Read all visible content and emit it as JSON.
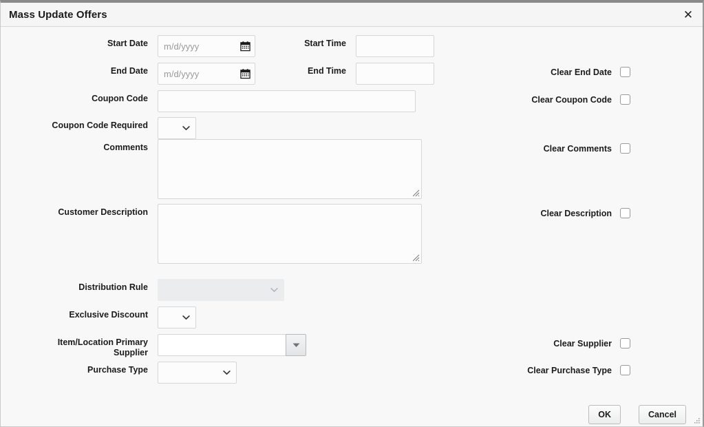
{
  "dialog": {
    "title": "Mass Update Offers",
    "close_icon": "close-icon"
  },
  "fields": {
    "start_date": {
      "label": "Start Date",
      "value": "",
      "placeholder": "m/d/yyyy",
      "icon": "calendar-icon"
    },
    "start_time": {
      "label": "Start Time",
      "value": "",
      "placeholder": ""
    },
    "end_date": {
      "label": "End Date",
      "value": "",
      "placeholder": "m/d/yyyy",
      "icon": "calendar-icon"
    },
    "end_time": {
      "label": "End Time",
      "value": "",
      "placeholder": ""
    },
    "coupon_code": {
      "label": "Coupon Code",
      "value": "",
      "placeholder": ""
    },
    "coupon_code_required": {
      "label": "Coupon Code Required",
      "value": "",
      "icon": "chevron-down-icon"
    },
    "comments": {
      "label": "Comments",
      "value": "",
      "placeholder": ""
    },
    "customer_description": {
      "label": "Customer Description",
      "value": "",
      "placeholder": ""
    },
    "distribution_rule": {
      "label": "Distribution Rule",
      "value": "",
      "disabled": true,
      "icon": "chevron-down-icon"
    },
    "exclusive_discount": {
      "label": "Exclusive Discount",
      "value": "",
      "icon": "chevron-down-icon"
    },
    "item_location_primary_supplier": {
      "label": "Item/Location Primary\nSupplier",
      "value": "",
      "placeholder": "",
      "icon": "dropdown-triangle-icon"
    },
    "purchase_type": {
      "label": "Purchase Type",
      "value": "",
      "icon": "chevron-down-icon"
    }
  },
  "clear_options": [
    {
      "label": "Clear End Date",
      "checked": false
    },
    {
      "label": "Clear Coupon Code",
      "checked": false
    },
    {
      "label": "Clear Comments",
      "checked": false
    },
    {
      "label": "Clear Description",
      "checked": false
    },
    {
      "label": "Clear Supplier",
      "checked": false
    },
    {
      "label": "Clear Purchase Type",
      "checked": false
    }
  ],
  "footer": {
    "ok_label": "OK",
    "cancel_label": "Cancel"
  },
  "colors": {
    "title_text": "#1a1a1a",
    "body_bg": "#f8f8f8",
    "input_border": "#d4d7da",
    "disabled_bg": "#ebecee",
    "placeholder": "#9b9b9b"
  }
}
